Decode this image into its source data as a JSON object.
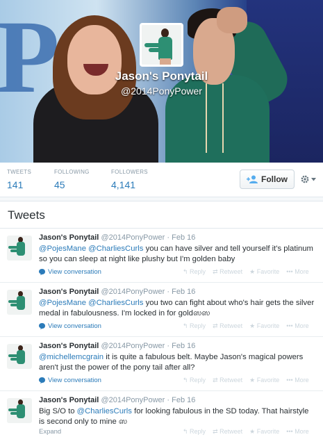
{
  "profile": {
    "name": "Jason's Ponytail",
    "handle": "@2014PonyPower"
  },
  "stats": [
    {
      "label": "TWEETS",
      "value": "141"
    },
    {
      "label": "FOLLOWING",
      "value": "45"
    },
    {
      "label": "FOLLOWERS",
      "value": "4,141"
    }
  ],
  "actions": {
    "follow_label": "Follow",
    "gear_icon": "gear-icon"
  },
  "tweets_section": {
    "title": "Tweets"
  },
  "tweets": [
    {
      "name": "Jason's Ponytail",
      "handle": "@2014PonyPower",
      "time": "Feb 16",
      "line1_m1": "@PojesMane",
      "line1_m2": "@CharliesCurls",
      "line1_rest": "you can have silver and tell yourself it's platinum",
      "line2": "so you can sleep at night like plushy but I'm golden baby",
      "link": "View conversation"
    },
    {
      "name": "Jason's Ponytail",
      "handle": "@2014PonyPower",
      "time": "Feb 16",
      "line1_m1": "@PojesMane",
      "line1_m2": "@CharliesCurls",
      "line1_rest": "you two can fight about who's hair gets the silver",
      "line2": "medal in fabulousness. I'm locked in for goldஸஸ",
      "link": "View conversation"
    },
    {
      "name": "Jason's Ponytail",
      "handle": "@2014PonyPower",
      "time": "Feb 16",
      "line1_m1": "@michellemcgrain",
      "line1_rest": "it is quite a fabulous belt. Maybe Jason's magical powers",
      "line2": "aren't just the power of the pony tail after all?",
      "link": "View conversation"
    },
    {
      "name": "Jason's Ponytail",
      "handle": "@2014PonyPower",
      "time": "Feb 16",
      "line1_pre": "Big S/O to",
      "line1_m1": "@CharliesCurls",
      "line1_rest": "for looking fabulous in the SD today. That hairstyle",
      "line2": "is second only to mine ஸ",
      "link": "Expand"
    }
  ],
  "tweet_actions": {
    "reply": "Reply",
    "retweet": "Retweet",
    "favorite": "Favorite",
    "more": "More"
  },
  "colors": {
    "link": "#2b7bb9",
    "muted": "#8899a6",
    "accent_green": "#2d8f73"
  }
}
